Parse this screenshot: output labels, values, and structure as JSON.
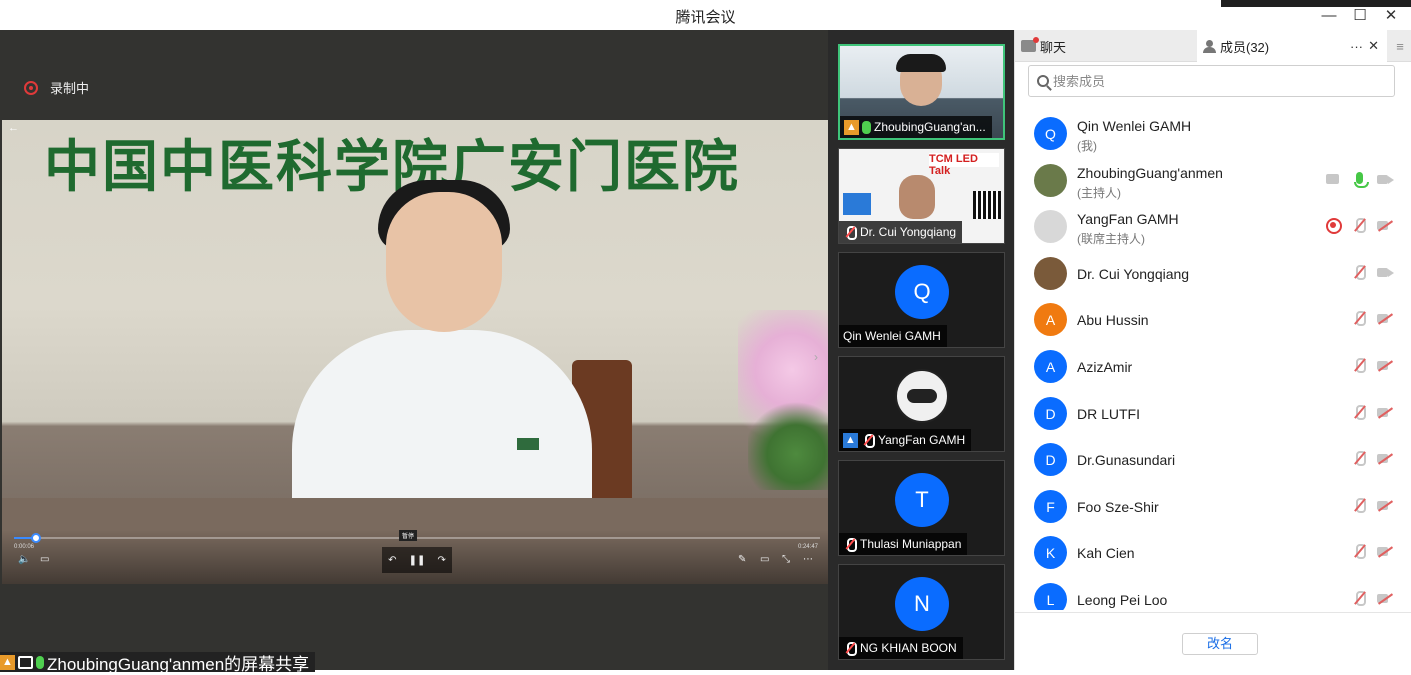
{
  "window": {
    "title": "腾讯会议",
    "min_glyph": "—",
    "max_glyph": "☐",
    "close_glyph": "✕"
  },
  "recording": {
    "label": "录制中"
  },
  "video": {
    "banner_text": "中国中医科学院广安门医院",
    "player": {
      "elapsed": "0:00:06",
      "duration": "0:24:47",
      "progress_fraction": 0.027,
      "tooltip": "暂停"
    }
  },
  "share_label": {
    "text": "ZhoubingGuang'anmen的屏幕共享"
  },
  "video_tiles": [
    {
      "name": "ZhoubingGuang'an...",
      "type": "video",
      "active": true,
      "mic": "on",
      "badge": "host"
    },
    {
      "name": "Dr. Cui Yongqiang",
      "type": "video",
      "active": false,
      "mic": "muted"
    },
    {
      "name": "Qin Wenlei GAMH",
      "type": "avatar",
      "initial": "Q",
      "active": false,
      "mic": "none"
    },
    {
      "name": "YangFan GAMH",
      "type": "avatar-image",
      "active": false,
      "mic": "muted",
      "badge": "host"
    },
    {
      "name": "Thulasi Muniappan",
      "type": "avatar",
      "initial": "T",
      "active": false,
      "mic": "muted"
    },
    {
      "name": "NG KHIAN BOON",
      "type": "avatar",
      "initial": "N",
      "active": false,
      "mic": "muted"
    }
  ],
  "panel": {
    "tab_chat": "聊天",
    "tab_members": "成员(32)",
    "more_glyph": "···",
    "close_glyph": "✕",
    "menu_glyph": "≡",
    "search_placeholder": "搜索成员",
    "rename_button": "改名"
  },
  "members": [
    {
      "name": "Qin Wenlei GAMH",
      "role": "(我)",
      "initial": "Q",
      "color": "#0a6cff",
      "controls": []
    },
    {
      "name": "ZhoubingGuang'anmen",
      "role": "(主持人)",
      "initial": "",
      "color": "#6a7a4a",
      "controls": [
        "share",
        "mic-live",
        "cam-off"
      ]
    },
    {
      "name": "YangFan GAMH",
      "role": "(联席主持人)",
      "initial": "",
      "color": "#d8d8d8",
      "controls": [
        "recording",
        "mic-muted",
        "cam-off-x"
      ]
    },
    {
      "name": "Dr. Cui Yongqiang",
      "role": "",
      "initial": "",
      "color": "#7a5a3a",
      "controls": [
        "mic-muted",
        "cam-off"
      ]
    },
    {
      "name": "Abu Hussin",
      "role": "",
      "initial": "A",
      "color": "#f07a10",
      "controls": [
        "mic-muted",
        "cam-off-x"
      ]
    },
    {
      "name": "AzizAmir",
      "role": "",
      "initial": "A",
      "color": "#0a6cff",
      "controls": [
        "mic-muted",
        "cam-off-x"
      ]
    },
    {
      "name": "DR LUTFI",
      "role": "",
      "initial": "D",
      "color": "#0a6cff",
      "controls": [
        "mic-muted",
        "cam-off-x"
      ]
    },
    {
      "name": "Dr.Gunasundari",
      "role": "",
      "initial": "D",
      "color": "#0a6cff",
      "controls": [
        "mic-muted",
        "cam-off-x"
      ]
    },
    {
      "name": "Foo Sze-Shir",
      "role": "",
      "initial": "F",
      "color": "#0a6cff",
      "controls": [
        "mic-muted",
        "cam-off-x"
      ]
    },
    {
      "name": "Kah Cien",
      "role": "",
      "initial": "K",
      "color": "#0a6cff",
      "controls": [
        "mic-muted",
        "cam-off-x"
      ]
    },
    {
      "name": "Leong Pei Loo",
      "role": "",
      "initial": "L",
      "color": "#0a6cff",
      "controls": [
        "mic-muted",
        "cam-off-x"
      ]
    }
  ]
}
